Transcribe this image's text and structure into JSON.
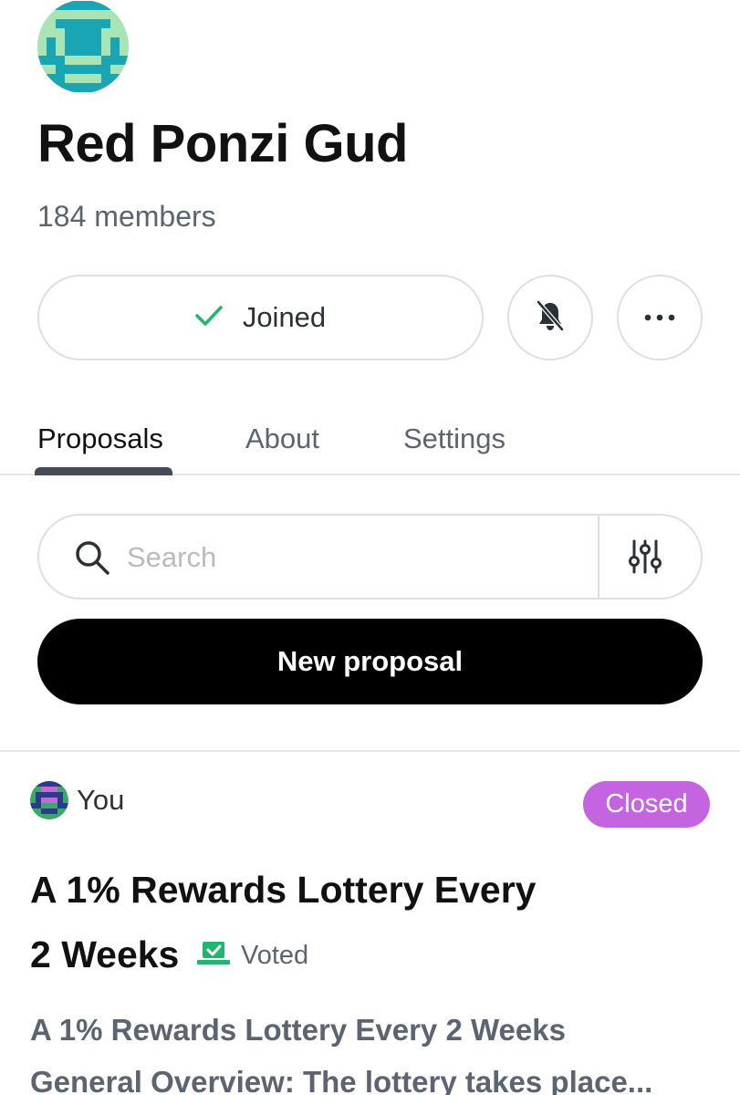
{
  "space": {
    "name": "Red Ponzi Gud",
    "members": "184 members",
    "joined_label": "Joined"
  },
  "tabs": [
    {
      "label": "Proposals",
      "active": true
    },
    {
      "label": "About",
      "active": false
    },
    {
      "label": "Settings",
      "active": false
    }
  ],
  "search": {
    "placeholder": "Search",
    "value": ""
  },
  "actions": {
    "new_proposal_label": "New proposal"
  },
  "proposal": {
    "author": "You",
    "status": "Closed",
    "title_line1": "A 1% Rewards Lottery Every",
    "title_line2": "2 Weeks",
    "voted_label": "Voted",
    "body_line1": "A 1% Rewards Lottery Every 2 Weeks",
    "body_line2": "General Overview: The lottery takes place..."
  },
  "colors": {
    "status_closed": "#c464e0",
    "joined_check": "#21b66f",
    "voted_icon": "#21b66f",
    "primary_button": "#000000"
  },
  "icons": {
    "joined": "check-icon",
    "notifications": "bell-off-icon",
    "more": "ellipsis-icon",
    "search": "search-icon",
    "filter": "sliders-icon",
    "voted": "ballot-check-icon"
  }
}
